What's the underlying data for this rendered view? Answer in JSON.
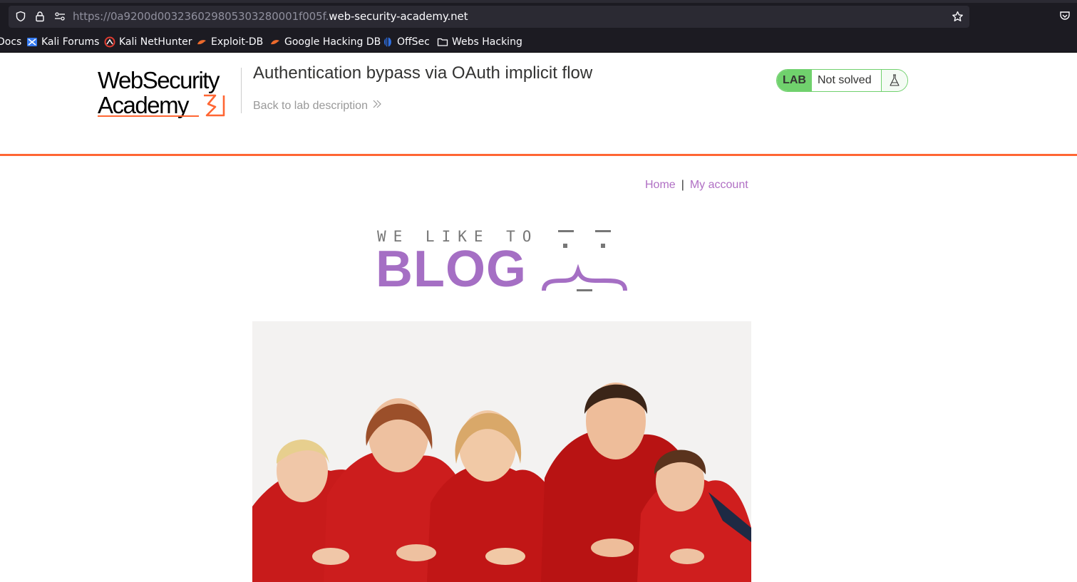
{
  "browser": {
    "url_prefix": "https://0a9200d003236029805303280001f005f.",
    "url_domain": "web-security-academy.net",
    "icons": [
      "shield-icon",
      "lock-icon",
      "permissions-icon",
      "star-icon",
      "pocket-icon"
    ]
  },
  "bookmarks": [
    {
      "label": "Docs",
      "icon": "none"
    },
    {
      "label": "Kali Forums",
      "icon": "kali-forums-icon"
    },
    {
      "label": "Kali NetHunter",
      "icon": "nethunter-icon"
    },
    {
      "label": "Exploit-DB",
      "icon": "exploit-db-icon"
    },
    {
      "label": "Google Hacking DB",
      "icon": "ghdb-icon"
    },
    {
      "label": "OffSec",
      "icon": "offsec-icon"
    },
    {
      "label": "Webs Hacking",
      "icon": "folder-icon"
    }
  ],
  "lab": {
    "logo_line1": "WebSecurity",
    "logo_line2": "Academy",
    "title": "Authentication bypass via OAuth implicit flow",
    "back_link": "Back to lab description",
    "badge": "LAB",
    "status": "Not solved"
  },
  "nav": {
    "home": "Home",
    "separator": "|",
    "my_account": "My account"
  },
  "banner": {
    "small_text": "WE LIKE TO",
    "big_text": "BLOG"
  },
  "colors": {
    "accent_orange": "#ff6633",
    "lab_green": "#70d16d",
    "blog_purple": "#a56fc4"
  }
}
